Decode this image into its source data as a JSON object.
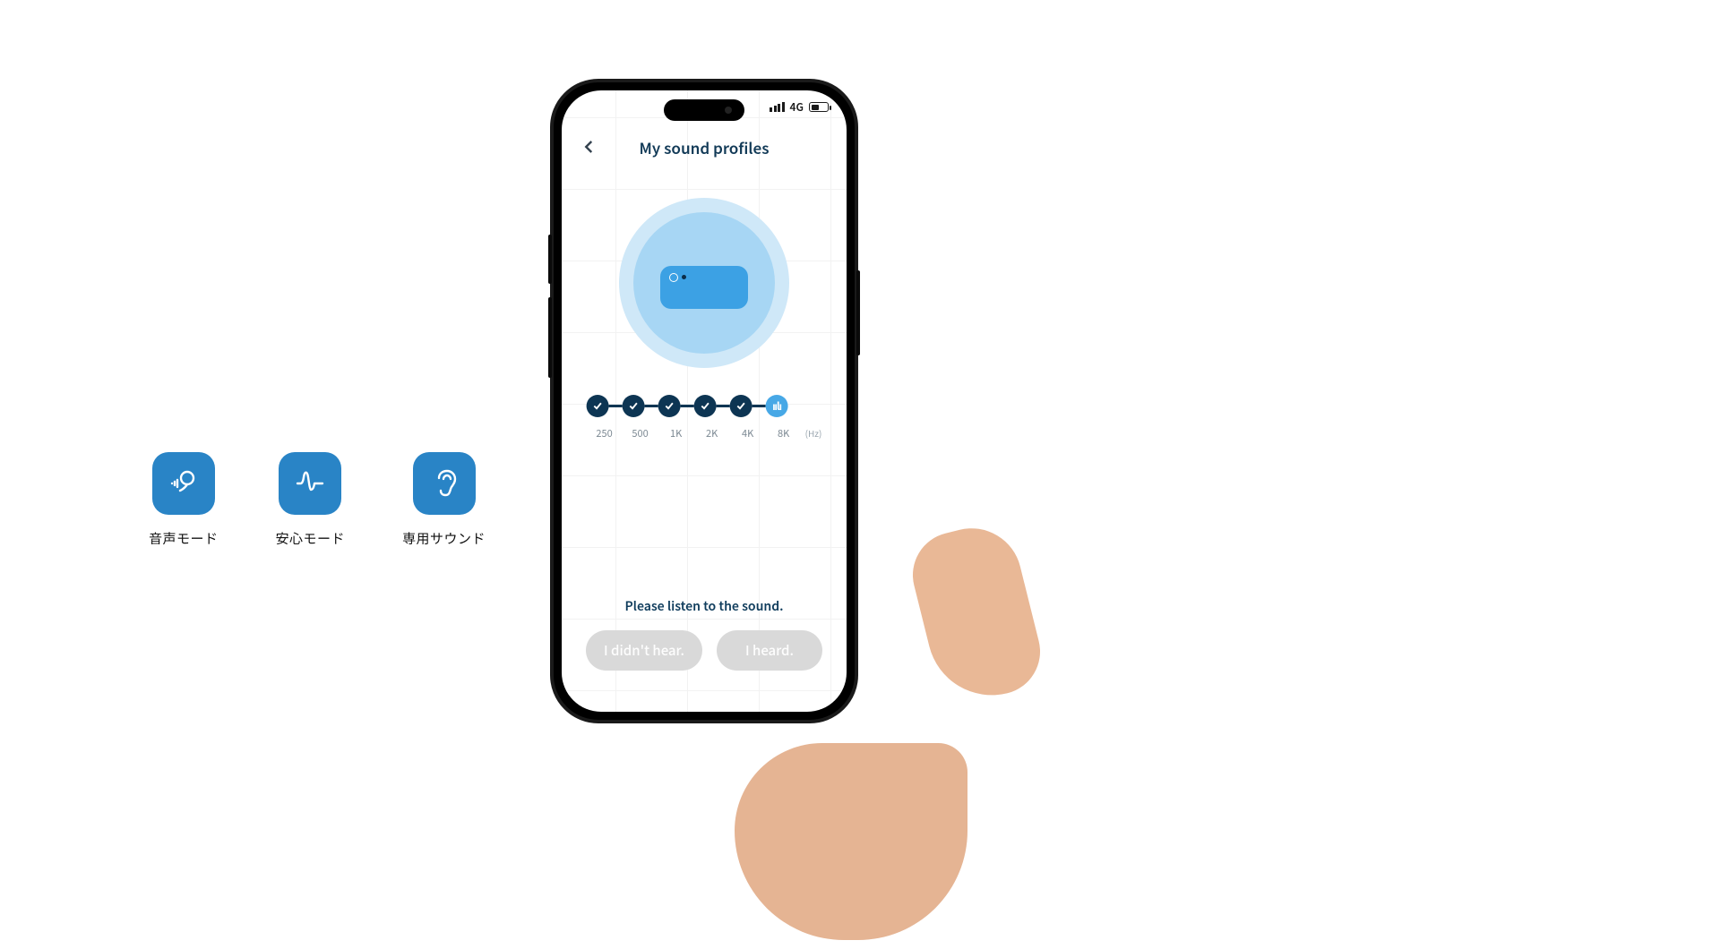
{
  "features": [
    {
      "id": "voice-mode",
      "label": "音声モード"
    },
    {
      "id": "safe-mode",
      "label": "安心モード"
    },
    {
      "id": "personal-sound",
      "label": "専用サウンド"
    }
  ],
  "statusbar": {
    "network_label": "4G"
  },
  "app": {
    "title": "My sound profiles",
    "prompt": "Please listen to the sound.",
    "buttons": {
      "didnt_hear": "I didn't hear.",
      "heard": "I heard."
    },
    "freq": {
      "unit": "(Hz)",
      "steps": [
        {
          "hz": "250",
          "done": true,
          "active": false
        },
        {
          "hz": "500",
          "done": true,
          "active": false
        },
        {
          "hz": "1K",
          "done": true,
          "active": false
        },
        {
          "hz": "2K",
          "done": true,
          "active": false
        },
        {
          "hz": "4K",
          "done": true,
          "active": false
        },
        {
          "hz": "8K",
          "done": false,
          "active": true
        }
      ]
    }
  }
}
